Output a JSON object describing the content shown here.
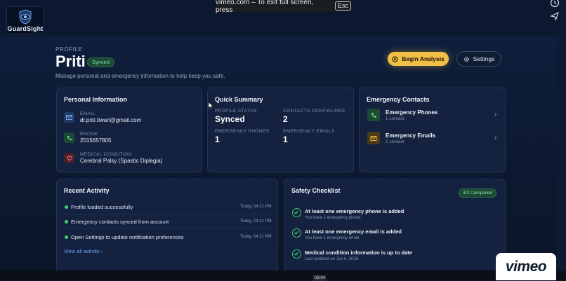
{
  "app": {
    "brand": "GuardSight"
  },
  "overlay": {
    "toast_text": "vimeo.com – To exit full screen, press",
    "esc_key": "Esc",
    "timecode": "03:04",
    "vimeo_logo": "vimeo"
  },
  "header": {
    "section_label": "PROFILE",
    "title": "Priti",
    "status_badge": "Synced",
    "subtitle": "Manage personal and emergency information to help keep you safe.",
    "primary_button": "Begin Analysis",
    "settings_button": "Settings"
  },
  "personal_info": {
    "title": "Personal Information",
    "fields": [
      {
        "label": "EMAIL",
        "value": "dr.priti.tiwari@gmail.com",
        "icon": "mail-icon"
      },
      {
        "label": "PHONE",
        "value": "2015657805",
        "icon": "phone-icon"
      },
      {
        "label": "MEDICAL CONDITION",
        "value": "Cerebral Palsy (Spastic Diplegia)",
        "icon": "heart-icon"
      }
    ]
  },
  "quick_summary": {
    "title": "Quick Summary",
    "items": [
      {
        "label": "PROFILE STATUS",
        "value": "Synced"
      },
      {
        "label": "CONTACTS CONFIGURED",
        "value": "2"
      },
      {
        "label": "EMERGENCY PHONES",
        "value": "1"
      },
      {
        "label": "EMERGENCY EMAILS",
        "value": "1"
      }
    ]
  },
  "emergency_contacts": {
    "title": "Emergency Contacts",
    "items": [
      {
        "title": "Emergency Phones",
        "sub": "1 contact",
        "icon": "phone-icon"
      },
      {
        "title": "Emergency Emails",
        "sub": "1 contact",
        "icon": "mail-icon"
      }
    ]
  },
  "recent_activity": {
    "title": "Recent Activity",
    "items": [
      {
        "text": "Profile loaded successfully",
        "time": "Today, 04:21 PM"
      },
      {
        "text": "Emergency contacts synced from account",
        "time": "Today, 04:21 PM"
      },
      {
        "text": "Open Settings to update notification preferences",
        "time": "Today, 04:21 PM"
      }
    ],
    "view_all": "View all activity ›"
  },
  "safety_checklist": {
    "title": "Safety Checklist",
    "badge": "3/3 Completed",
    "items": [
      {
        "title": "At least one emergency phone is added",
        "sub": "You have 1 emergency phone."
      },
      {
        "title": "At least one emergency email is added",
        "sub": "You have 1 emergency email."
      },
      {
        "title": "Medical condition information is up to date",
        "sub": "Last updated on Jun 6, 2026."
      }
    ]
  },
  "colors": {
    "accent": "#f2bf46",
    "success": "#3ccf74",
    "background": "#0d1a33",
    "card": "#142240"
  }
}
